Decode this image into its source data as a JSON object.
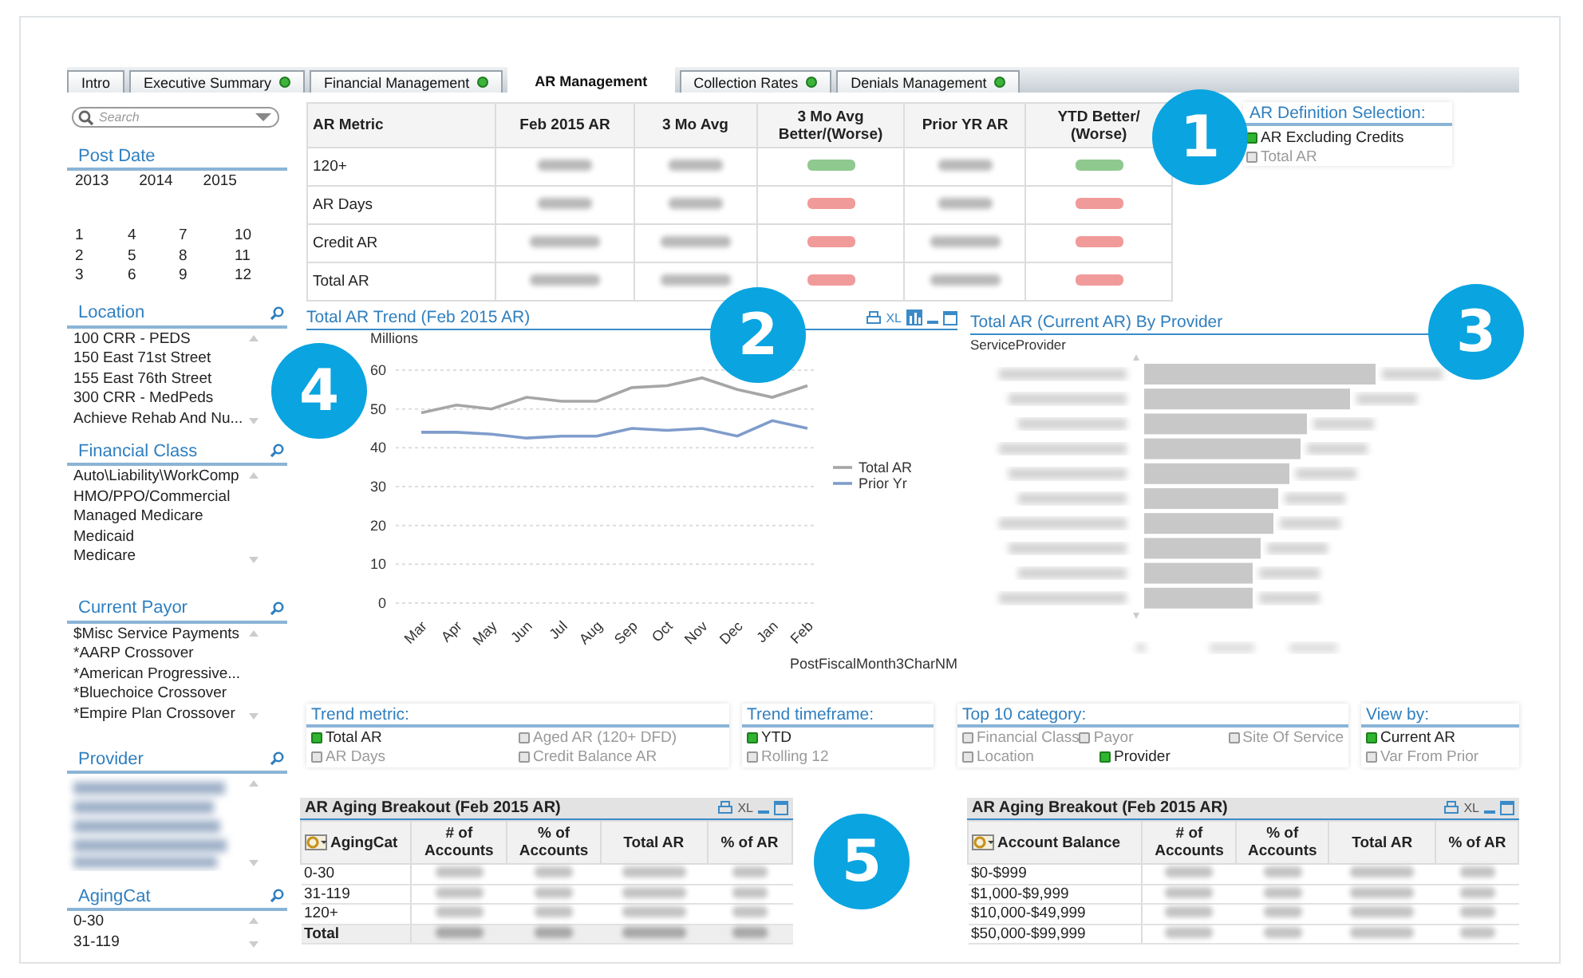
{
  "tabs": [
    {
      "label": "Intro",
      "selected": false,
      "indicator": false
    },
    {
      "label": "Executive Summary",
      "selected": false,
      "indicator": true
    },
    {
      "label": "Financial Management",
      "selected": false,
      "indicator": true
    },
    {
      "label": "AR Management",
      "selected": true,
      "indicator": false
    },
    {
      "label": "Collection Rates",
      "selected": false,
      "indicator": true
    },
    {
      "label": "Denials Management",
      "selected": false,
      "indicator": true
    }
  ],
  "sidebar": {
    "search": {
      "placeholder": "Search"
    },
    "post_date": {
      "title": "Post Date",
      "years": [
        "2013",
        "2014",
        "2015"
      ],
      "months": [
        "1",
        "4",
        "7",
        "10",
        "2",
        "5",
        "8",
        "11",
        "3",
        "6",
        "9",
        "12"
      ]
    },
    "list_boxes": [
      {
        "title": "Location",
        "kind": "list",
        "items": [
          "100 CRR - PEDS",
          "150 East 71st Street",
          "155 East 76th Street",
          "300 CRR - MedPeds",
          "Achieve Rehab And Nu..."
        ]
      },
      {
        "title": "Financial Class",
        "kind": "list",
        "items": [
          "Auto\\Liability\\WorkComp",
          "HMO/PPO/Commercial",
          "Managed Medicare",
          "Medicaid",
          "Medicare"
        ]
      },
      {
        "title": "Current Payor",
        "kind": "list",
        "items": [
          "$Misc Service Payments",
          "*AARP Crossover",
          "*American Progressive...",
          "*Bluechoice Crossover",
          "*Empire Plan Crossover"
        ]
      },
      {
        "title": "Provider",
        "kind": "blurred"
      },
      {
        "title": "AgingCat",
        "kind": "list",
        "items": [
          "0-30",
          "31-119"
        ]
      }
    ]
  },
  "metrics_table": {
    "columns": [
      "AR Metric",
      "Feb 2015 AR",
      "3 Mo Avg",
      "3 Mo Avg Better/(Worse)",
      "Prior YR AR",
      "YTD Better/ (Worse)"
    ],
    "rows": [
      {
        "metric": "120+",
        "color": "#8fc98f"
      },
      {
        "metric": "AR Days",
        "color": "#f19a9a"
      },
      {
        "metric": "Credit AR",
        "color": "#f19a9a"
      },
      {
        "metric": "Total AR",
        "color": "#f19a9a"
      }
    ]
  },
  "ar_definition": {
    "title": "AR Definition Selection:",
    "options": [
      {
        "label": "AR Excluding Credits",
        "selected": true
      },
      {
        "label": "Total AR",
        "selected": false
      }
    ]
  },
  "trend_chart": {
    "title": "Total AR Trend (Feb 2015 AR)",
    "export_label": "XL",
    "chart_data": {
      "type": "line",
      "ylabel": "Millions",
      "xlabel": "PostFiscalMonth3CharNM",
      "categories": [
        "Mar",
        "Apr",
        "May",
        "Jun",
        "Jul",
        "Aug",
        "Sep",
        "Oct",
        "Nov",
        "Dec",
        "Jan",
        "Feb"
      ],
      "series": [
        {
          "name": "Total AR",
          "color": "#a6a6a6",
          "values": [
            49,
            51,
            50,
            53,
            52,
            52,
            55.5,
            56,
            58,
            55,
            53,
            56
          ]
        },
        {
          "name": "Prior Yr",
          "color": "#7f9ccb",
          "values": [
            44,
            44,
            43.5,
            42.5,
            43,
            43,
            45,
            44.5,
            45,
            43,
            47,
            45
          ]
        }
      ],
      "ylim": [
        0,
        60
      ],
      "yticks": [
        0,
        10,
        20,
        30,
        40,
        50,
        60
      ],
      "grid": true,
      "legend": true
    }
  },
  "provider_chart": {
    "title": "Total AR (Current AR) By Provider",
    "subtitle": "ServiceProvider"
  },
  "selectors": [
    {
      "title": "Trend metric:",
      "rows": [
        [
          {
            "label": "Total AR",
            "selected": true
          },
          {
            "label": "Aged AR (120+ DFD)",
            "selected": false
          }
        ],
        [
          {
            "label": "AR Days",
            "selected": false
          },
          {
            "label": "Credit Balance AR",
            "selected": false
          }
        ]
      ]
    },
    {
      "title": "Trend timeframe:",
      "rows": [
        [
          {
            "label": "YTD",
            "selected": true
          }
        ],
        [
          {
            "label": "Rolling 12",
            "selected": false
          }
        ]
      ]
    },
    {
      "title": "Top 10 category:",
      "rows": [
        [
          {
            "label": "Financial Class",
            "selected": false
          },
          {
            "label": "Payor",
            "selected": false
          },
          {
            "label": "Site Of Service",
            "selected": false
          }
        ],
        [
          {
            "label": "Location",
            "selected": false
          },
          {
            "label": "Provider",
            "selected": true
          }
        ]
      ]
    },
    {
      "title": "View by:",
      "rows": [
        [
          {
            "label": "Current AR",
            "selected": true
          }
        ],
        [
          {
            "label": "Var From Prior",
            "selected": false
          }
        ]
      ]
    }
  ],
  "aging_tables": [
    {
      "title": "AR Aging Breakout (Feb 2015 AR)",
      "export_label": "XL",
      "columns": [
        "AgingCat",
        "# of Accounts",
        "% of Accounts",
        "Total AR",
        "% of AR"
      ],
      "rows": [
        {
          "label": "0-30",
          "kind": "data"
        },
        {
          "label": "31-119",
          "kind": "data"
        },
        {
          "label": "120+",
          "kind": "data"
        },
        {
          "label": "Total",
          "kind": "total"
        }
      ]
    },
    {
      "title": "AR Aging Breakout (Feb 2015 AR)",
      "export_label": "XL",
      "columns": [
        "Account Balance",
        "# of Accounts",
        "% of Accounts",
        "Total AR",
        "% of AR"
      ],
      "rows": [
        {
          "label": "$0-$999",
          "kind": "data"
        },
        {
          "label": "$1,000-$9,999",
          "kind": "data"
        },
        {
          "label": "$10,000-$49,999",
          "kind": "data"
        },
        {
          "label": "$50,000-$99,999",
          "kind": "data"
        }
      ]
    }
  ],
  "callouts": [
    "1",
    "2",
    "3",
    "4",
    "5"
  ]
}
